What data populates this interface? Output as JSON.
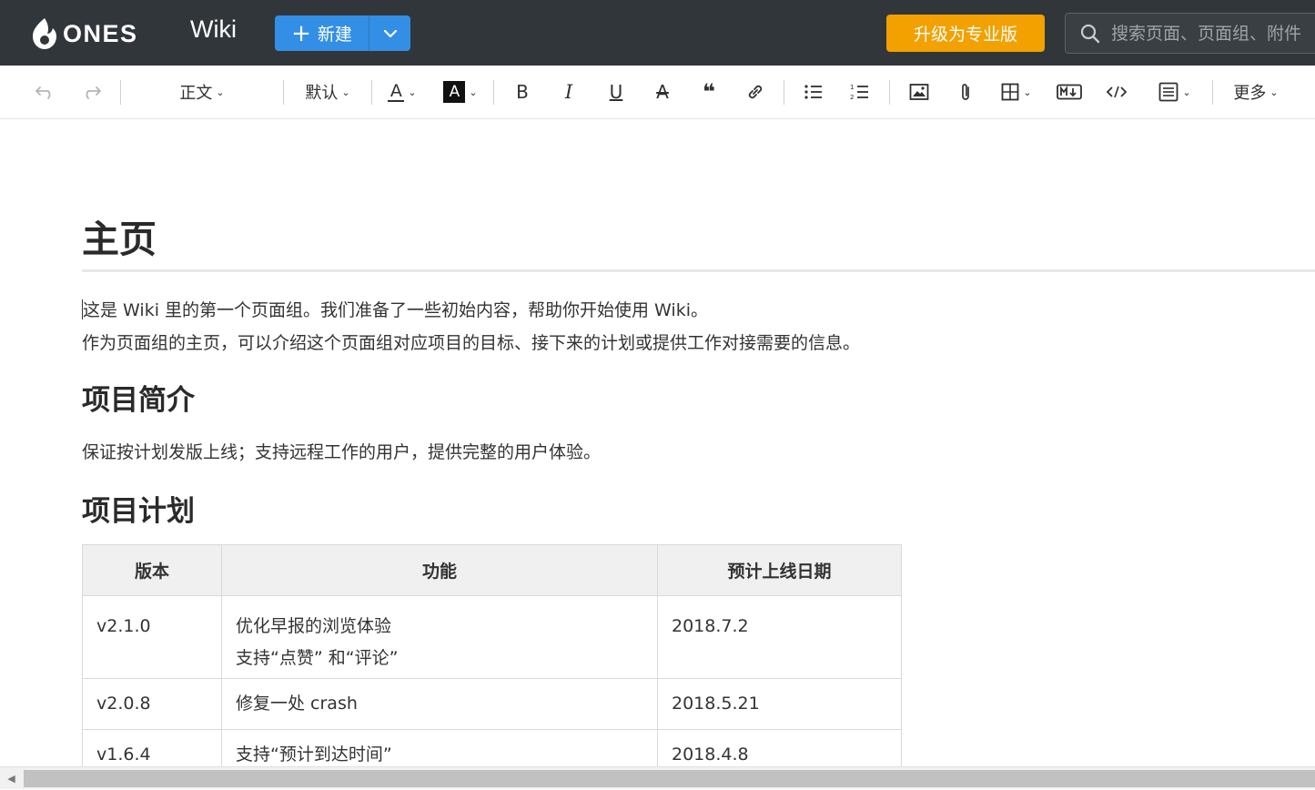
{
  "header": {
    "logo_text": "ONES",
    "app_title": "Wiki",
    "new_button_label": "新建",
    "upgrade_label": "升级为专业版",
    "search_placeholder": "搜索页面、页面组、附件"
  },
  "toolbar": {
    "paragraph_style": "正文",
    "font_default": "默认",
    "text_color_glyph": "A",
    "highlight_glyph": "A",
    "bold_glyph": "B",
    "italic_glyph": "I",
    "underline_glyph": "U",
    "strike_glyph": "A",
    "quote_glyph": "❝",
    "more_label": "更多"
  },
  "document": {
    "title": "主页",
    "intro_line1": "这是 Wiki 里的第一个页面组。我们准备了一些初始内容，帮助你开始使用 Wiki。",
    "intro_line2": "作为页面组的主页，可以介绍这个页面组对应项目的目标、接下来的计划或提供工作对接需要的信息。",
    "section1_heading": "项目简介",
    "section1_text": "保证按计划发版上线；支持远程工作的用户，提供完整的用户体验。",
    "section2_heading": "项目计划",
    "table": {
      "headers": [
        "版本",
        "功能",
        "预计上线日期"
      ],
      "rows": [
        {
          "version": "v2.1.0",
          "features": [
            "优化早报的浏览体验",
            "支持“点赞” 和“评论”"
          ],
          "date": "2018.7.2"
        },
        {
          "version": "v2.0.8",
          "features": [
            "修复一处 crash"
          ],
          "date": "2018.5.21"
        },
        {
          "version": "v1.6.4",
          "features": [
            "支持“预计到达时间”"
          ],
          "date": "2018.4.8"
        }
      ]
    }
  }
}
